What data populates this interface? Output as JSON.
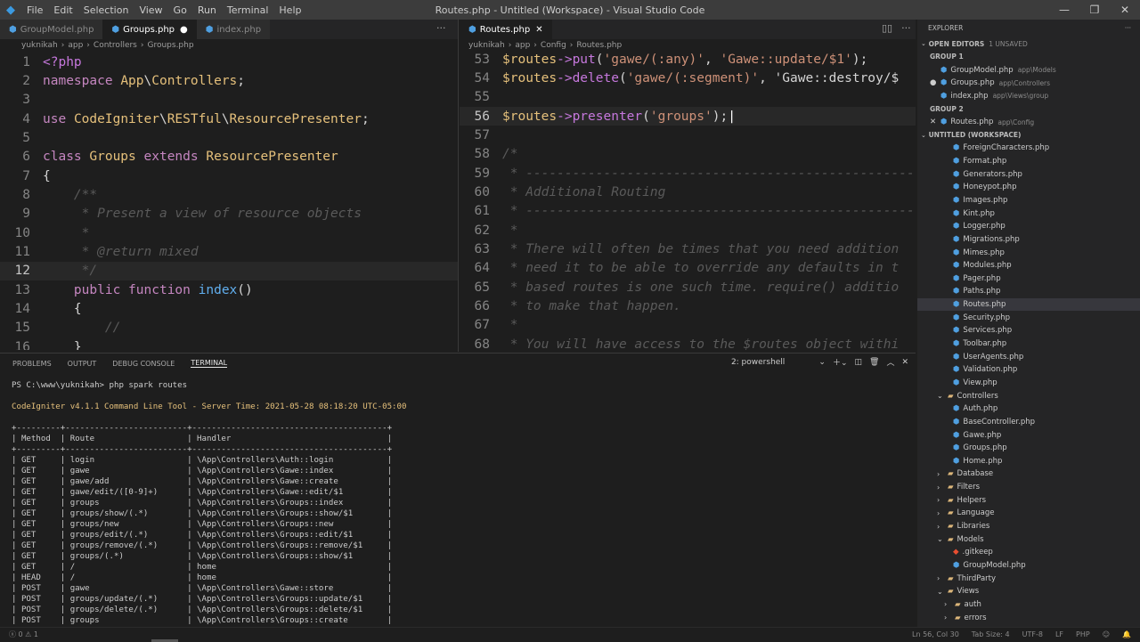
{
  "window": {
    "title": "Routes.php - Untitled (Workspace) - Visual Studio Code",
    "menu": [
      "File",
      "Edit",
      "Selection",
      "View",
      "Go",
      "Run",
      "Terminal",
      "Help"
    ]
  },
  "left_editor": {
    "tabs": [
      {
        "label": "GroupModel.php",
        "active": false
      },
      {
        "label": "Groups.php",
        "active": true,
        "dirty": true
      },
      {
        "label": "index.php",
        "active": false
      }
    ],
    "breadcrumb": [
      "yuknikah",
      "app",
      "Controllers",
      "Groups.php"
    ],
    "lines": [
      {
        "n": "1",
        "t": "<?php"
      },
      {
        "n": "2",
        "t": "namespace App\\Controllers;"
      },
      {
        "n": "3",
        "t": ""
      },
      {
        "n": "4",
        "t": "use CodeIgniter\\RESTful\\ResourcePresenter;"
      },
      {
        "n": "5",
        "t": ""
      },
      {
        "n": "6",
        "t": "class Groups extends ResourcePresenter"
      },
      {
        "n": "7",
        "t": "{"
      },
      {
        "n": "8",
        "t": "    /**",
        "c": true
      },
      {
        "n": "9",
        "t": "     * Present a view of resource objects",
        "c": true
      },
      {
        "n": "10",
        "t": "     *",
        "c": true
      },
      {
        "n": "11",
        "t": "     * @return mixed",
        "c": true
      },
      {
        "n": "12",
        "t": "     */",
        "c": true
      },
      {
        "n": "13",
        "t": "    public function index()"
      },
      {
        "n": "14",
        "t": "    {"
      },
      {
        "n": "15",
        "t": "        //",
        "c": true
      },
      {
        "n": "16",
        "t": "    }"
      }
    ]
  },
  "right_editor": {
    "tabs": [
      {
        "label": "Routes.php",
        "active": true
      }
    ],
    "breadcrumb": [
      "yuknikah",
      "app",
      "Config",
      "Routes.php"
    ],
    "lines": [
      {
        "n": "53",
        "t": "$routes->put('gawe/(:any)', 'Gawe::update/$1');"
      },
      {
        "n": "54",
        "t": "$routes->delete('gawe/(:segment)', 'Gawe::destroy/$"
      },
      {
        "n": "55",
        "t": ""
      },
      {
        "n": "56",
        "t": "$routes->presenter('groups');"
      },
      {
        "n": "57",
        "t": ""
      },
      {
        "n": "58",
        "t": "/*",
        "c": true
      },
      {
        "n": "59",
        "t": " * --------------------------------------------------",
        "c": true
      },
      {
        "n": "60",
        "t": " * Additional Routing",
        "c": true
      },
      {
        "n": "61",
        "t": " * --------------------------------------------------",
        "c": true
      },
      {
        "n": "62",
        "t": " *",
        "c": true
      },
      {
        "n": "63",
        "t": " * There will often be times that you need addition",
        "c": true
      },
      {
        "n": "64",
        "t": " * need it to be able to override any defaults in t",
        "c": true
      },
      {
        "n": "65",
        "t": " * based routes is one such time. require() additio",
        "c": true
      },
      {
        "n": "66",
        "t": " * to make that happen.",
        "c": true
      },
      {
        "n": "67",
        "t": " *",
        "c": true
      },
      {
        "n": "68",
        "t": " * You will have access to the $routes object withi",
        "c": true
      }
    ]
  },
  "panel": {
    "tabs": [
      "PROBLEMS",
      "OUTPUT",
      "DEBUG CONSOLE",
      "TERMINAL"
    ],
    "active_tab": "TERMINAL",
    "terminal_select": "2: powershell",
    "prompt": "PS C:\\www\\yuknikah> php spark routes",
    "banner": "CodeIgniter v4.1.1 Command Line Tool - Server Time: 2021-05-28 08:18:20 UTC-05:00",
    "border": "+---------+-------------------------+----------------------------------------+",
    "headers": [
      "Method",
      "Route",
      "Handler"
    ],
    "rows": [
      [
        "GET",
        "login",
        "\\App\\Controllers\\Auth::login"
      ],
      [
        "GET",
        "gawe",
        "\\App\\Controllers\\Gawe::index"
      ],
      [
        "GET",
        "gawe/add",
        "\\App\\Controllers\\Gawe::create"
      ],
      [
        "GET",
        "gawe/edit/([0-9]+)",
        "\\App\\Controllers\\Gawe::edit/$1"
      ],
      [
        "GET",
        "groups",
        "\\App\\Controllers\\Groups::index"
      ],
      [
        "GET",
        "groups/show/(.*)",
        "\\App\\Controllers\\Groups::show/$1"
      ],
      [
        "GET",
        "groups/new",
        "\\App\\Controllers\\Groups::new"
      ],
      [
        "GET",
        "groups/edit/(.*)",
        "\\App\\Controllers\\Groups::edit/$1"
      ],
      [
        "GET",
        "groups/remove/(.*)",
        "\\App\\Controllers\\Groups::remove/$1"
      ],
      [
        "GET",
        "groups/(.*)",
        "\\App\\Controllers\\Groups::show/$1"
      ],
      [
        "GET",
        "/",
        "home"
      ],
      [
        "HEAD",
        "/",
        "home"
      ],
      [
        "POST",
        "gawe",
        "\\App\\Controllers\\Gawe::store"
      ],
      [
        "POST",
        "groups/update/(.*)",
        "\\App\\Controllers\\Groups::update/$1"
      ],
      [
        "POST",
        "groups/delete/(.*)",
        "\\App\\Controllers\\Groups::delete/$1"
      ],
      [
        "POST",
        "groups",
        "\\App\\Controllers\\Groups::create"
      ]
    ]
  },
  "explorer": {
    "title": "EXPLORER",
    "open_editors": "OPEN EDITORS",
    "unsaved": "1 UNSAVED",
    "group1": "GROUP 1",
    "group2": "GROUP 2",
    "workspace": "UNTITLED (WORKSPACE)",
    "open_g1": [
      {
        "name": "GroupModel.php",
        "path": "app\\Models"
      },
      {
        "name": "Groups.php",
        "path": "app\\Controllers"
      },
      {
        "name": "index.php",
        "path": "app\\Views\\group"
      }
    ],
    "open_g2": [
      {
        "name": "Routes.php",
        "path": "app\\Config"
      }
    ],
    "tree": [
      {
        "name": "ForeignCharacters.php",
        "d": 2
      },
      {
        "name": "Format.php",
        "d": 2
      },
      {
        "name": "Generators.php",
        "d": 2
      },
      {
        "name": "Honeypot.php",
        "d": 2
      },
      {
        "name": "Images.php",
        "d": 2
      },
      {
        "name": "Kint.php",
        "d": 2
      },
      {
        "name": "Logger.php",
        "d": 2
      },
      {
        "name": "Migrations.php",
        "d": 2
      },
      {
        "name": "Mimes.php",
        "d": 2
      },
      {
        "name": "Modules.php",
        "d": 2
      },
      {
        "name": "Pager.php",
        "d": 2
      },
      {
        "name": "Paths.php",
        "d": 2
      },
      {
        "name": "Routes.php",
        "d": 2,
        "sel": true
      },
      {
        "name": "Security.php",
        "d": 2
      },
      {
        "name": "Services.php",
        "d": 2
      },
      {
        "name": "Toolbar.php",
        "d": 2
      },
      {
        "name": "UserAgents.php",
        "d": 2
      },
      {
        "name": "Validation.php",
        "d": 2
      },
      {
        "name": "View.php",
        "d": 2
      },
      {
        "name": "Controllers",
        "d": 1,
        "folder": "open"
      },
      {
        "name": "Auth.php",
        "d": 2
      },
      {
        "name": "BaseController.php",
        "d": 2
      },
      {
        "name": "Gawe.php",
        "d": 2
      },
      {
        "name": "Groups.php",
        "d": 2
      },
      {
        "name": "Home.php",
        "d": 2
      },
      {
        "name": "Database",
        "d": 1,
        "folder": "closed"
      },
      {
        "name": "Filters",
        "d": 1,
        "folder": "closed"
      },
      {
        "name": "Helpers",
        "d": 1,
        "folder": "closed"
      },
      {
        "name": "Language",
        "d": 1,
        "folder": "closed"
      },
      {
        "name": "Libraries",
        "d": 1,
        "folder": "closed"
      },
      {
        "name": "Models",
        "d": 1,
        "folder": "open"
      },
      {
        "name": ".gitkeep",
        "d": 2,
        "git": true
      },
      {
        "name": "GroupModel.php",
        "d": 2
      },
      {
        "name": "ThirdParty",
        "d": 1,
        "folder": "closed"
      },
      {
        "name": "Views",
        "d": 1,
        "folder": "open"
      },
      {
        "name": "auth",
        "d": 2,
        "folder": "closed"
      },
      {
        "name": "errors",
        "d": 2,
        "folder": "closed"
      }
    ]
  },
  "status": {
    "errors": "0",
    "warnings": "1",
    "position": "Ln 56, Col 30",
    "tab_size": "Tab Size: 4",
    "encoding": "UTF-8",
    "eol": "LF",
    "language": "PHP"
  },
  "colors": {
    "accent": "#007acc",
    "keyword": "#c586c0",
    "class": "#e5c07b",
    "string": "#ce9178",
    "func": "#c678dd"
  }
}
